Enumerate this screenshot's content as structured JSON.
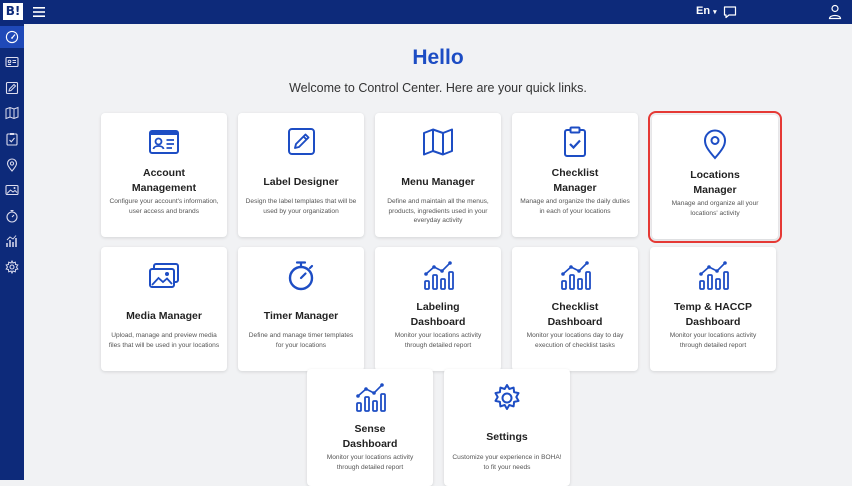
{
  "topbar": {
    "logo_text": "B!",
    "language": "En",
    "hamburger_icon": "menu-icon",
    "chat_icon": "chat-icon",
    "user_icon": "user-icon"
  },
  "sidebar": {
    "items": [
      {
        "icon": "dashboard-gauge-icon",
        "active": true
      },
      {
        "icon": "id-card-icon"
      },
      {
        "icon": "pencil-icon"
      },
      {
        "icon": "map-icon"
      },
      {
        "icon": "clipboard-check-icon"
      },
      {
        "icon": "location-pin-icon"
      },
      {
        "icon": "image-icon"
      },
      {
        "icon": "timer-icon"
      },
      {
        "icon": "chart-icon"
      },
      {
        "icon": "gear-icon"
      }
    ]
  },
  "main": {
    "heading": "Hello",
    "welcome": "Welcome to Control Center. Here are your quick links."
  },
  "cards": [
    {
      "title_1": "Account",
      "title_2": "Management",
      "description_1": "Configure your account's information,",
      "description_2": "user access and brands",
      "description_3": ""
    },
    {
      "title_1": "Label Designer",
      "title_2": "",
      "description_1": "Design the label templates that will be",
      "description_2": "used by your organization",
      "description_3": ""
    },
    {
      "title_1": "Menu Manager",
      "title_2": "",
      "description_1": "Define and maintain all the menus,",
      "description_2": "products, ingredients used in your",
      "description_3": "everyday activity"
    },
    {
      "title_1": "Checklist",
      "title_2": "Manager",
      "description_1": "Manage and organize the daily duties",
      "description_2": "in each of your locations",
      "description_3": ""
    },
    {
      "title_1": "Locations",
      "title_2": "Manager",
      "description_1": "Manage and organize all your",
      "description_2": "locations' activity",
      "description_3": ""
    },
    {
      "title_1": "Media Manager",
      "title_2": "",
      "description_1": "Upload, manage and preview media",
      "description_2": "files that will be used in your locations",
      "description_3": ""
    },
    {
      "title_1": "Timer Manager",
      "title_2": "",
      "description_1": "Define and manage timer templates",
      "description_2": "for your locations",
      "description_3": ""
    },
    {
      "title_1": "Labeling",
      "title_2": "Dashboard",
      "description_1": "Monitor your locations activity",
      "description_2": "through detailed report",
      "description_3": ""
    },
    {
      "title_1": "Checklist",
      "title_2": "Dashboard",
      "description_1": "Monitor your locations day to day",
      "description_2": "execution of checklist tasks",
      "description_3": ""
    },
    {
      "title_1": "Temp & HACCP",
      "title_2": "Dashboard",
      "description_1": "Monitor your locations activity",
      "description_2": "through detailed report",
      "description_3": ""
    },
    {
      "title_1": "Sense",
      "title_2": "Dashboard",
      "description_1": "Monitor your locations activity",
      "description_2": "through detailed report",
      "description_3": ""
    },
    {
      "title_1": "Settings",
      "title_2": "",
      "description_1": "Customize your experience in BOHA!",
      "description_2": "to fit your needs",
      "description_3": ""
    }
  ],
  "colors": {
    "navy": "#0d2a7a",
    "active": "#1f49b8",
    "accent": "#1d4dc4",
    "background": "#f1f2f4",
    "highlight": "#e53935"
  }
}
